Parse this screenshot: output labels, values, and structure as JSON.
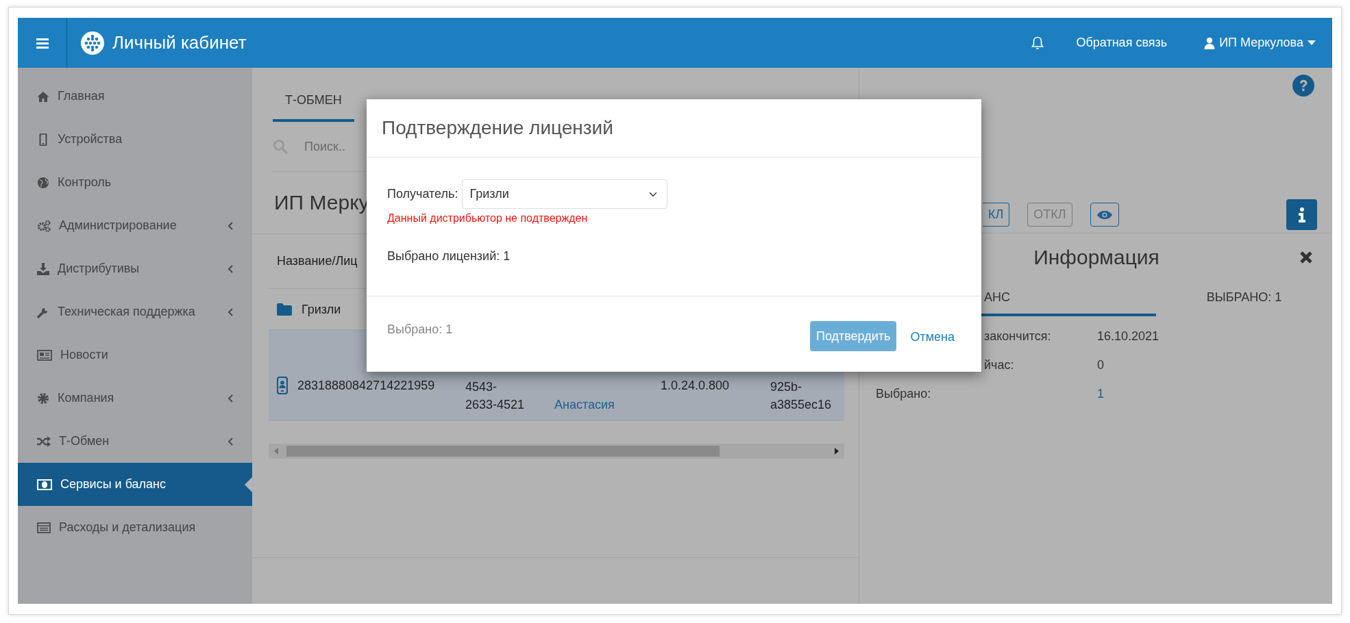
{
  "topbar": {
    "title": "Личный кабинет",
    "feedback": "Обратная связь",
    "user": "ИП Меркулова"
  },
  "sidebar": {
    "items": [
      {
        "label": "Главная",
        "expandable": false,
        "selected": false
      },
      {
        "label": "Устройства",
        "expandable": false,
        "selected": false
      },
      {
        "label": "Контроль",
        "expandable": false,
        "selected": false
      },
      {
        "label": "Администрирование",
        "expandable": true,
        "selected": false
      },
      {
        "label": "Дистрибутивы",
        "expandable": true,
        "selected": false
      },
      {
        "label": "Техническая поддержка",
        "expandable": true,
        "selected": false
      },
      {
        "label": "Новости",
        "expandable": false,
        "selected": false
      },
      {
        "label": "Компания",
        "expandable": true,
        "selected": false
      },
      {
        "label": "Т-Обмен",
        "expandable": true,
        "selected": false
      },
      {
        "label": "Сервисы и баланс",
        "expandable": false,
        "selected": true
      },
      {
        "label": "Расходы и детализация",
        "expandable": false,
        "selected": false
      }
    ]
  },
  "main": {
    "tabs": [
      {
        "label": "Т-ОБМЕН",
        "selected": true
      }
    ],
    "search": {
      "placeholder": "Поиск.."
    },
    "heading": "ИП Мерку",
    "table": {
      "columns": [
        "Название/Лиц"
      ],
      "rows": [
        {
          "kind": "folder",
          "selected": false,
          "cells": [
            {
              "text": "Гризли",
              "link": false
            }
          ]
        },
        {
          "kind": "device",
          "selected": true,
          "cells": [
            {
              "text": "28318880842714221959",
              "link": false
            },
            {
              "text": "4543-\n2633-4521",
              "link": false
            },
            {
              "text": "Анастасия",
              "link": true
            },
            {
              "text": "1.0.24.0.800",
              "link": false
            },
            {
              "text": "925b-\na3855ec16",
              "link": false
            }
          ]
        }
      ]
    }
  },
  "panel": {
    "toggles": [
      {
        "kind": "on",
        "label": "КЛ",
        "clipped": true
      },
      {
        "kind": "off",
        "label": "ОТКЛ",
        "clipped": false
      },
      {
        "kind": "view",
        "clipped": false
      }
    ],
    "info": {
      "title": "Информация",
      "tabs": [
        {
          "label": "АНС",
          "selected": true,
          "clipped": true
        },
        {
          "label": "ВЫБРАНО: 1",
          "selected": false,
          "clipped": false
        }
      ],
      "rows": [
        {
          "label": "закончится:",
          "value": "16.10.2021",
          "clipped": true,
          "link": false
        },
        {
          "label": "йчас:",
          "value": "0",
          "clipped": true,
          "link": false
        },
        {
          "label": "Выбрано:",
          "value": "1",
          "clipped": false,
          "link": true
        }
      ]
    }
  },
  "modal": {
    "title": "Подтверждение лицензий",
    "recipient": {
      "label": "Получатель:",
      "value": "Гризли"
    },
    "error": "Данный дистрибьютор не подтвержден",
    "count": "Выбрано лицензий: 1",
    "footer_note": "Выбрано: 1",
    "buttons": [
      {
        "kind": "primary",
        "label": "Подтвердить"
      },
      {
        "kind": "link",
        "label": "Отмена"
      }
    ]
  }
}
